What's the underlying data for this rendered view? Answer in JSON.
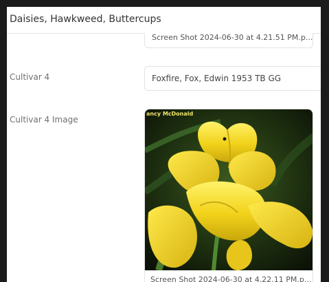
{
  "header": {
    "title": "Daisies, Hawkweed, Buttercups"
  },
  "previous_image": {
    "caption": "Screen Shot 2024-06-30 at 4.21.51 PM.p..."
  },
  "fields": [
    {
      "label": "Cultivar 4",
      "value": "Foxfire, Fox, Edwin  1953      TB GG"
    },
    {
      "label": "Cultivar 4 Image"
    }
  ],
  "image": {
    "subject": "yellow tall bearded iris photo",
    "credit": "ancy McDonald",
    "caption": "Screen Shot 2024-06-30 at 4.22.11 PM.p..."
  }
}
